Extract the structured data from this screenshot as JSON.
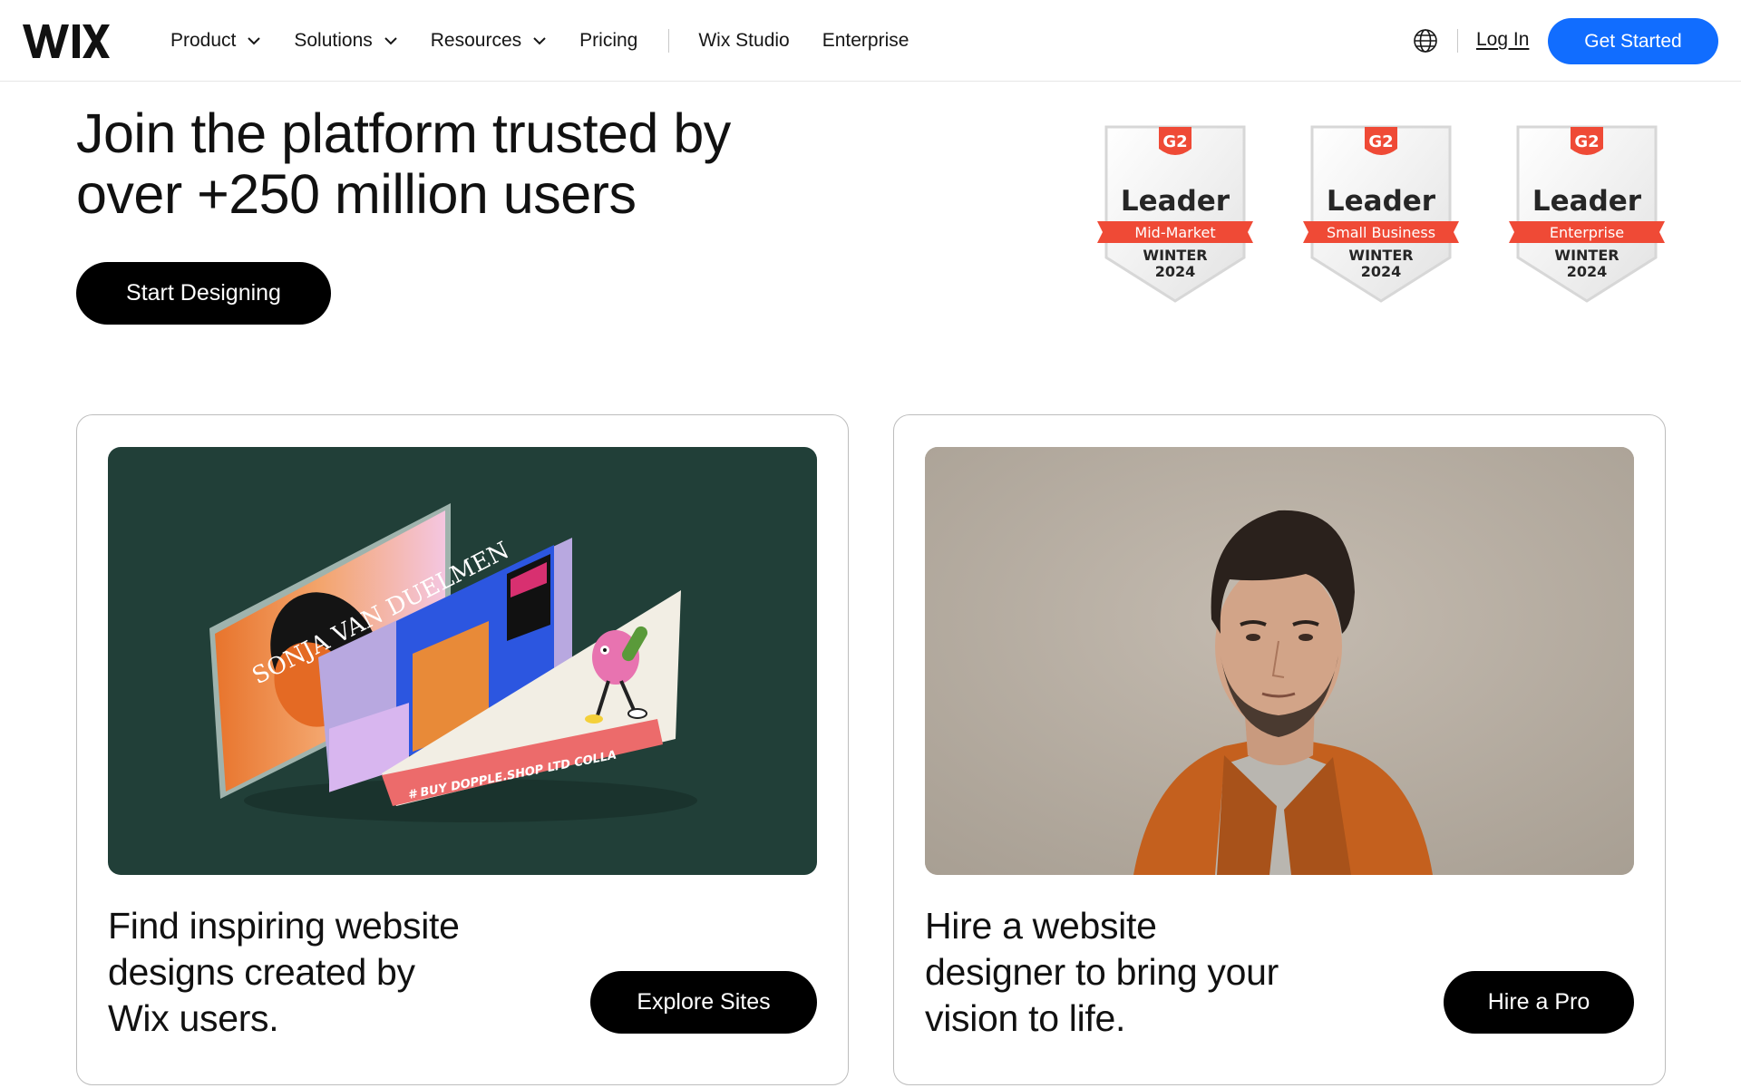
{
  "header": {
    "logo": "WIX",
    "nav": [
      {
        "label": "Product",
        "dropdown": true
      },
      {
        "label": "Solutions",
        "dropdown": true
      },
      {
        "label": "Resources",
        "dropdown": true
      },
      {
        "label": "Pricing",
        "dropdown": false
      }
    ],
    "nav_secondary": [
      {
        "label": "Wix Studio"
      },
      {
        "label": "Enterprise"
      }
    ],
    "login_label": "Log In",
    "cta_label": "Get Started",
    "globe_icon": "globe-icon"
  },
  "hero": {
    "title_line1": "Join the platform trusted by",
    "title_line2": "over +250 million users",
    "cta_label": "Start Designing"
  },
  "badges": [
    {
      "logo": "G2",
      "title": "Leader",
      "category": "Mid-Market",
      "season": "WINTER",
      "year": "2024"
    },
    {
      "logo": "G2",
      "title": "Leader",
      "category": "Small Business",
      "season": "WINTER",
      "year": "2024"
    },
    {
      "logo": "G2",
      "title": "Leader",
      "category": "Enterprise",
      "season": "WINTER",
      "year": "2024"
    }
  ],
  "cards": [
    {
      "text_lines": [
        "Find inspiring website",
        "designs created by",
        "Wix users."
      ],
      "button_label": "Explore Sites",
      "image_label": "SONJA VAN DUELMEN",
      "image_banner": "# BUY DOPPLE.SHOP LTD COLLA"
    },
    {
      "text_lines": [
        "Hire a website",
        "designer to bring your",
        "vision to life."
      ],
      "button_label": "Hire a Pro"
    }
  ],
  "colors": {
    "brand_blue": "#116dff",
    "g2_red": "#ef4a36",
    "card_green": "#213f38",
    "photo_bg": "#b9b0a4",
    "jacket_orange": "#c4601e"
  }
}
